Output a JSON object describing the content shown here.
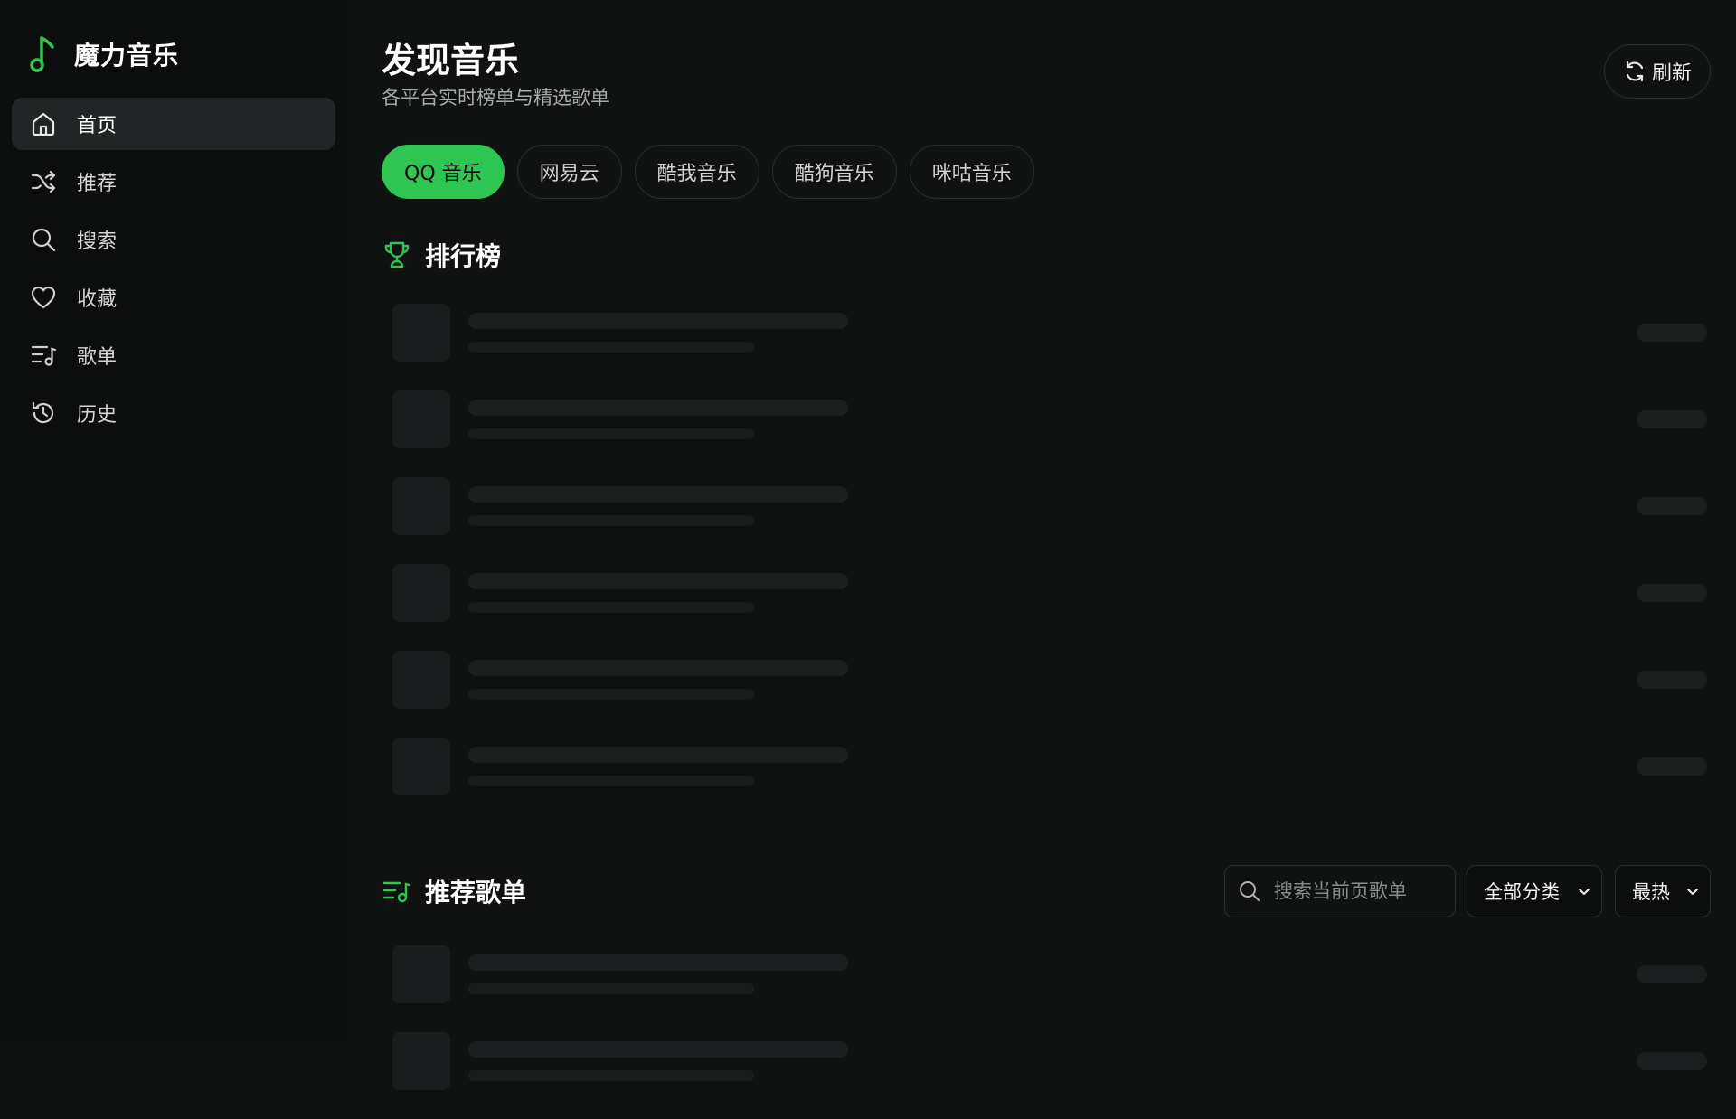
{
  "app": {
    "name": "魔力音乐",
    "accent": "#2fc552"
  },
  "sidebar": {
    "items": [
      {
        "label": "首页",
        "icon": "home-icon",
        "active": true
      },
      {
        "label": "推荐",
        "icon": "shuffle-icon",
        "active": false
      },
      {
        "label": "搜索",
        "icon": "search-icon",
        "active": false
      },
      {
        "label": "收藏",
        "icon": "heart-icon",
        "active": false
      },
      {
        "label": "歌单",
        "icon": "playlist-icon",
        "active": false
      },
      {
        "label": "历史",
        "icon": "history-icon",
        "active": false
      }
    ]
  },
  "header": {
    "title": "发现音乐",
    "subtitle": "各平台实时榜单与精选歌单",
    "refresh_label": "刷新"
  },
  "tabs": [
    {
      "label": "QQ 音乐",
      "active": true
    },
    {
      "label": "网易云",
      "active": false
    },
    {
      "label": "酷我音乐",
      "active": false
    },
    {
      "label": "酷狗音乐",
      "active": false
    },
    {
      "label": "咪咕音乐",
      "active": false
    }
  ],
  "charts_section": {
    "title": "排行榜"
  },
  "playlists_section": {
    "title": "推荐歌单",
    "search_placeholder": "搜索当前页歌单",
    "category_select": "全部分类",
    "sort_select": "最热"
  }
}
